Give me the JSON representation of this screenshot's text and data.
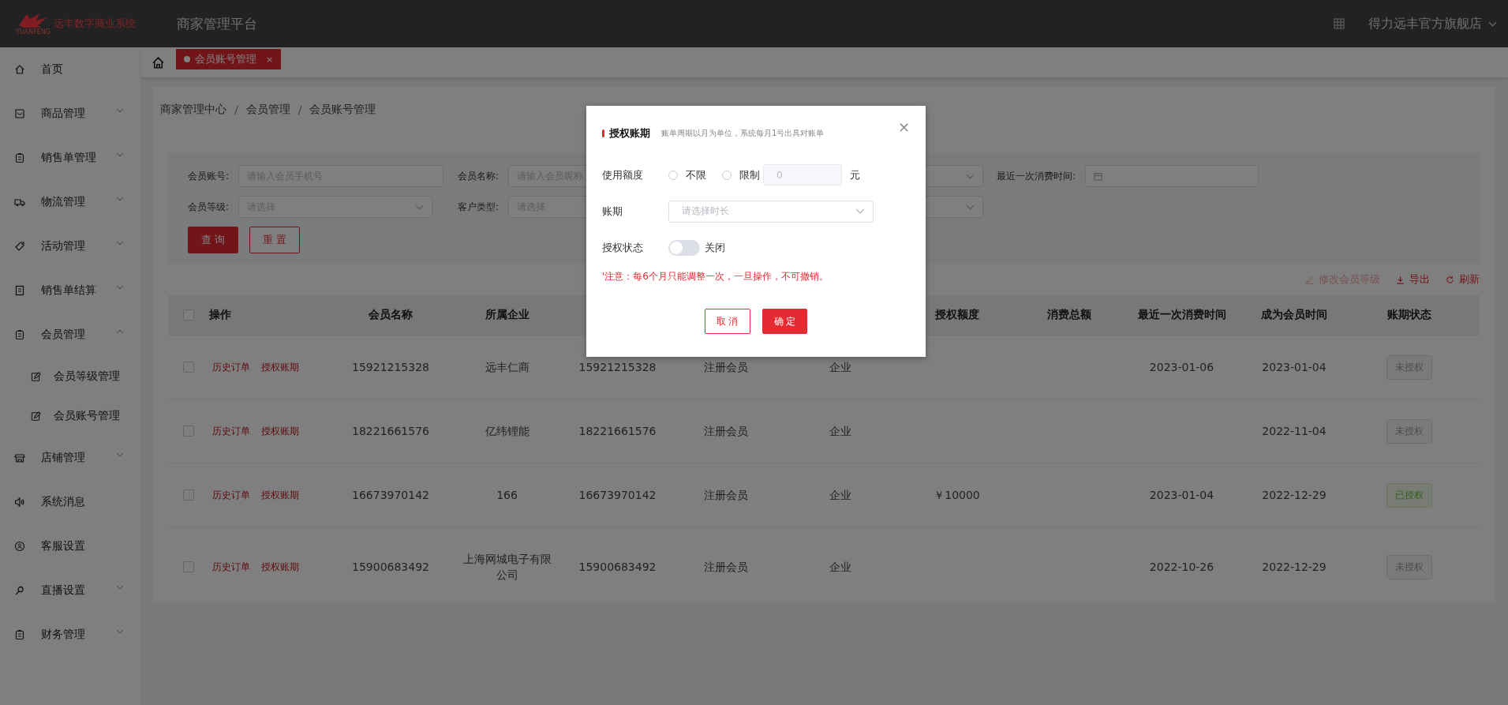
{
  "header": {
    "logo_text": "远丰数字商业系统",
    "logo_subtext": "YUANFENG",
    "platform": "商家管理平台",
    "store": "得力远丰官方旗舰店"
  },
  "sidebar": {
    "items": [
      {
        "label": "首页",
        "has_arrow": false
      },
      {
        "label": "商品管理",
        "has_arrow": true,
        "expanded": false
      },
      {
        "label": "销售单管理",
        "has_arrow": true,
        "expanded": false
      },
      {
        "label": "物流管理",
        "has_arrow": true,
        "expanded": false
      },
      {
        "label": "活动管理",
        "has_arrow": true,
        "expanded": false
      },
      {
        "label": "销售单结算",
        "has_arrow": true,
        "expanded": false
      },
      {
        "label": "会员管理",
        "has_arrow": true,
        "expanded": true,
        "children": [
          {
            "label": "会员等级管理"
          },
          {
            "label": "会员账号管理"
          }
        ]
      },
      {
        "label": "店铺管理",
        "has_arrow": true,
        "expanded": false
      },
      {
        "label": "系统消息",
        "has_arrow": false
      },
      {
        "label": "客服设置",
        "has_arrow": false
      },
      {
        "label": "直播设置",
        "has_arrow": true,
        "expanded": false
      },
      {
        "label": "财务管理",
        "has_arrow": true,
        "expanded": false
      }
    ]
  },
  "tabs": [
    {
      "label": "会员账号管理",
      "selected": true,
      "close": "×"
    }
  ],
  "breadcrumb": [
    "商家管理中心",
    "会员管理",
    "会员账号管理"
  ],
  "breadcrumb_separator": "/",
  "filters": {
    "row_1": [
      {
        "label": "会员账号:",
        "kind": "input",
        "placeholder": "请输入会员手机号"
      },
      {
        "label": "会员名称:",
        "kind": "input",
        "placeholder": "请输入会员昵称"
      },
      {
        "kind": "select"
      },
      {
        "label": "最近一次消费时间:",
        "kind": "date"
      }
    ],
    "row_2": [
      {
        "label": "会员等级:",
        "kind": "select",
        "placeholder": "请选择"
      },
      {
        "label": "客户类型:",
        "kind": "select",
        "placeholder": "请选择"
      },
      {
        "kind": "select"
      }
    ],
    "buttons": [
      {
        "label": "查 询",
        "kind": "primary"
      },
      {
        "label": "重 置",
        "kind": "outline"
      }
    ]
  },
  "toolbar": [
    {
      "label": "修改会员等级",
      "disabled": true
    },
    {
      "label": "导出",
      "disabled": false
    },
    {
      "label": "刷新",
      "disabled": false
    }
  ],
  "table": {
    "all_checked": false,
    "columns_left": [
      "操作",
      "会员名称",
      "所属企业"
    ],
    "columns_right": [
      "授权额度",
      "消费总额",
      "最近一次消费时间",
      "成为会员时间",
      "账期状态"
    ],
    "rows": [
      {
        "checked": false,
        "actions": [
          "历史订单",
          "授权账期"
        ],
        "member_name": "15921215328",
        "company": "远丰仁商",
        "column_4": "15921215328",
        "column_5": "注册会员",
        "column_6": "企业",
        "last_purchase": "2023-01-06",
        "joined": "2023-01-04",
        "status": {
          "label": "未授权",
          "authorized": false
        }
      },
      {
        "checked": false,
        "actions": [
          "历史订单",
          "授权账期"
        ],
        "member_name": "18221661576",
        "company": "亿纬锂能",
        "column_4": "18221661576",
        "column_5": "注册会员",
        "column_6": "企业",
        "joined": "2022-11-04",
        "status": {
          "label": "未授权",
          "authorized": false
        }
      },
      {
        "checked": false,
        "actions": [
          "历史订单",
          "授权账期"
        ],
        "member_name": "16673970142",
        "company": "166",
        "column_4": "16673970142",
        "column_5": "注册会员",
        "column_6": "企业",
        "credit_limit": "￥10000",
        "last_purchase": "2023-01-04",
        "joined": "2022-12-29",
        "status": {
          "label": "已授权",
          "authorized": true
        }
      },
      {
        "checked": false,
        "actions": [
          "历史订单",
          "授权账期"
        ],
        "member_name": "15900683492",
        "company": "上海网城电子有限公司",
        "column_4": "15900683492",
        "column_5": "注册会员",
        "column_6": "企业",
        "last_purchase": "2022-10-26",
        "joined": "2022-12-29",
        "status": {
          "label": "未授权",
          "authorized": false
        }
      }
    ]
  },
  "dialog": {
    "title": "授权账期",
    "subtitle": "账单周期以月为单位，系统每月1号出具对账单",
    "close": "×",
    "limit": {
      "label": "使用额度",
      "options": [
        {
          "label": "不限",
          "selected": false
        },
        {
          "label": "限制",
          "selected": false
        }
      ],
      "value": "0",
      "unit": "元"
    },
    "period": {
      "label": "账期",
      "placeholder": "请选择时长"
    },
    "status": {
      "label": "授权状态",
      "on": false,
      "text": "关闭"
    },
    "note": "'注意：每6个月只能调整一次，一旦操作，不可撤销。",
    "buttons": [
      {
        "label": "取 消",
        "kind": "outline"
      },
      {
        "label": "确 定",
        "kind": "primary"
      }
    ]
  }
}
